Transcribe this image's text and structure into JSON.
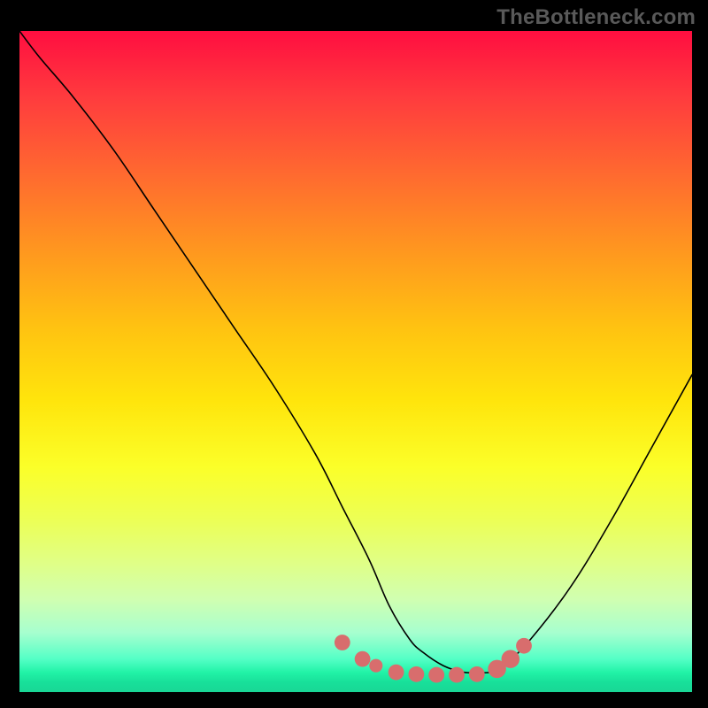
{
  "watermark": "TheBottleneck.com",
  "chart_data": {
    "type": "line",
    "title": "",
    "xlabel": "",
    "ylabel": "",
    "xlim": [
      0,
      100
    ],
    "ylim": [
      0,
      100
    ],
    "series": [
      {
        "name": "curve",
        "color": "#000000",
        "x": [
          0,
          3,
          8,
          14,
          20,
          26,
          32,
          38,
          44,
          48,
          52,
          55,
          58,
          60,
          63,
          66,
          68,
          70,
          72,
          76,
          82,
          88,
          94,
          100
        ],
        "values": [
          100,
          96,
          90,
          82,
          73,
          64,
          55,
          46,
          36,
          28,
          20,
          13,
          8,
          6,
          4,
          3,
          3,
          3,
          4,
          8,
          16,
          26,
          37,
          48
        ]
      }
    ],
    "markers": {
      "name": "highlight-dots",
      "color": "#d86d6d",
      "points": [
        {
          "x": 48.0,
          "y": 7.5,
          "r": 1.3
        },
        {
          "x": 51.0,
          "y": 5.0,
          "r": 1.3
        },
        {
          "x": 53.0,
          "y": 4.0,
          "r": 1.1
        },
        {
          "x": 56.0,
          "y": 3.0,
          "r": 1.3
        },
        {
          "x": 59.0,
          "y": 2.7,
          "r": 1.3
        },
        {
          "x": 62.0,
          "y": 2.6,
          "r": 1.3
        },
        {
          "x": 65.0,
          "y": 2.6,
          "r": 1.3
        },
        {
          "x": 68.0,
          "y": 2.7,
          "r": 1.3
        },
        {
          "x": 71.0,
          "y": 3.5,
          "r": 1.5
        },
        {
          "x": 73.0,
          "y": 5.0,
          "r": 1.5
        },
        {
          "x": 75.0,
          "y": 7.0,
          "r": 1.3
        }
      ]
    }
  }
}
